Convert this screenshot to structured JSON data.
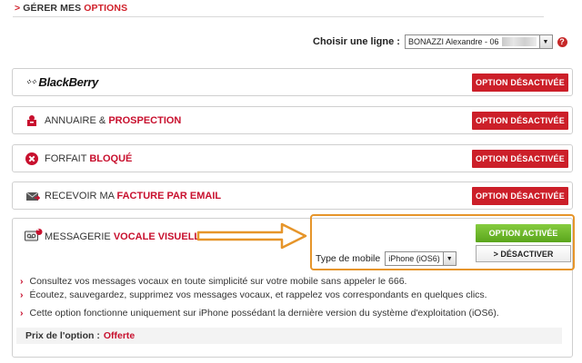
{
  "header": {
    "prefix": ">",
    "title_dark": "GÉRER MES",
    "title_accent": "OPTIONS"
  },
  "line_picker": {
    "label": "Choisir une ligne :",
    "selected": "BONAZZI Alexandre - 06"
  },
  "options": [
    {
      "brand": "BlackBerry",
      "button": "OPTION DÉSACTIVÉE"
    },
    {
      "title_plain": "ANNUAIRE &",
      "title_bold": "PROSPECTION",
      "button": "OPTION DÉSACTIVÉE"
    },
    {
      "title_plain": "FORFAIT",
      "title_bold": "BLOQUÉ",
      "button": "OPTION DÉSACTIVÉE"
    },
    {
      "title_plain": "RECEVOIR MA",
      "title_bold": "FACTURE PAR EMAIL",
      "button": "OPTION DÉSACTIVÉE"
    }
  ],
  "voicemail": {
    "title_plain": "MESSAGERIE",
    "title_bold": "VOCALE VISUELLE",
    "badge": "1",
    "button_on": "OPTION ACTIVÉE",
    "button_deactivate": "> DÉSACTIVER",
    "mobile_label": "Type de mobile",
    "mobile_value": "iPhone (iOS6)",
    "bullets": [
      "Consultez vos messages vocaux en toute simplicité sur votre mobile sans appeler le 666.",
      "Écoutez, sauvegardez, supprimez vos messages vocaux, et rappelez vos correspondants en quelques clics.",
      "Cette option fonctionne uniquement sur iPhone possédant la dernière version du système d'exploitation (iOS6)."
    ],
    "price_label": "Prix de l'option :",
    "price_value": "Offerte"
  },
  "colors": {
    "red": "#cc1f29",
    "green": "#6cb52b",
    "orange": "#e6952a"
  }
}
